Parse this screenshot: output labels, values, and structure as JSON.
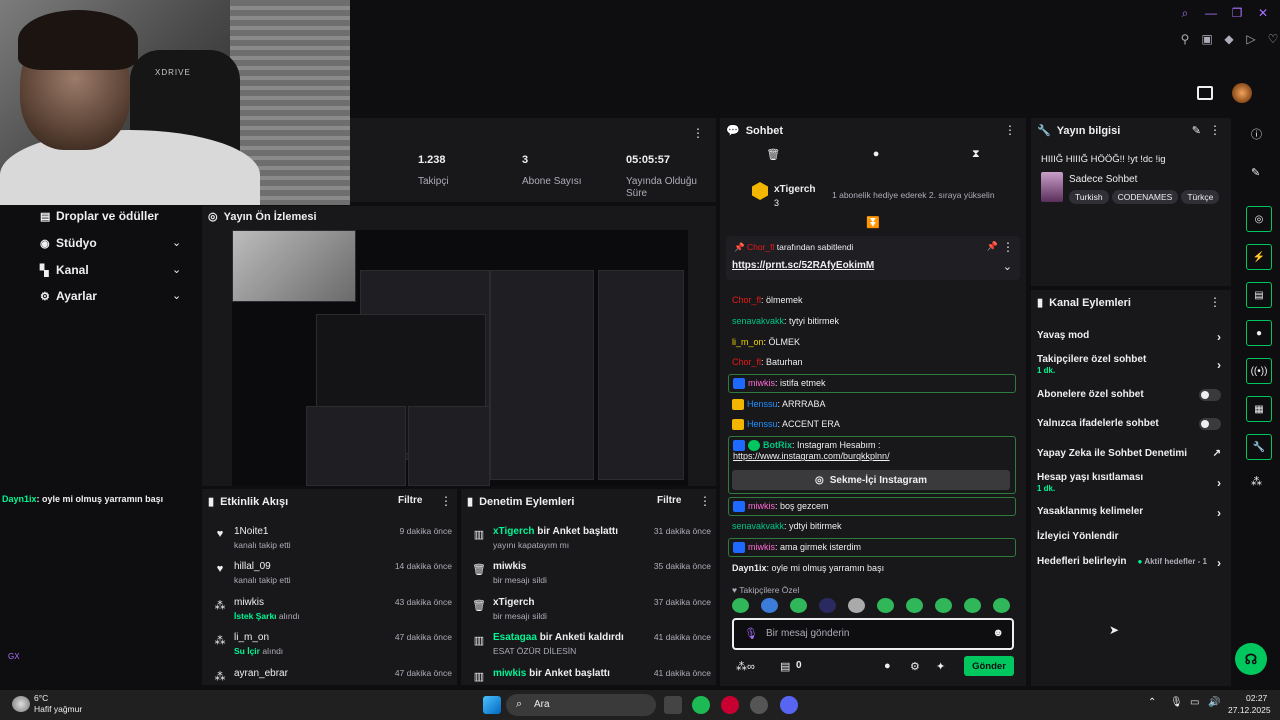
{
  "stats": [
    {
      "value": "1.238",
      "label": "Takipçi"
    },
    {
      "value": "3",
      "label": "Abone Sayısı"
    },
    {
      "value": "05:05:57",
      "label": "Yayında Olduğu Süre"
    }
  ],
  "leftnav": {
    "items": [
      {
        "label": "Droplar ve ödüller"
      },
      {
        "label": "Stüdyo"
      },
      {
        "label": "Kanal"
      },
      {
        "label": "Ayarlar"
      }
    ]
  },
  "cam": {
    "chair_brand": "XDRIVE"
  },
  "overlay_chat": {
    "user": "Dayn1ix",
    "text": ": oyle mi olmuş yarramın başı"
  },
  "preview": {
    "title": "Yayın Ön İzlemesi"
  },
  "activity": {
    "title": "Etkinlik Akışı",
    "filter": "Filtre",
    "items": [
      {
        "name": "1Noite1",
        "sub": "kanalı takip etti",
        "time": "9 dakika önce",
        "icon": "heart-icon"
      },
      {
        "name": "hillal_09",
        "sub": "kanalı takip etti",
        "time": "14 dakika önce",
        "icon": "heart-icon"
      },
      {
        "name": "miwkis",
        "sub": "İstek Şarkı",
        "sub2": "alındı",
        "time": "43 dakika önce",
        "icon": "points-icon"
      },
      {
        "name": "li_m_on",
        "sub": "Su İçir",
        "sub2": "alındı",
        "time": "47 dakika önce",
        "icon": "points-icon"
      },
      {
        "name": "ayran_ebrar",
        "sub": "",
        "time": "47 dakika önce",
        "icon": "points-icon"
      }
    ]
  },
  "mod": {
    "title": "Denetim Eylemleri",
    "filter": "Filtre",
    "items": [
      {
        "name": "xTigerch",
        "action": "bir Anket başlattı",
        "sub": "yayını kapatayım mı",
        "time": "31 dakika önce"
      },
      {
        "name": "miwkis",
        "action": "",
        "sub": "bir mesajı sildi",
        "time": "35 dakika önce"
      },
      {
        "name": "xTigerch",
        "action": "",
        "sub": "bir mesajı sildi",
        "time": "37 dakika önce"
      },
      {
        "name": "Esatagaa",
        "action": "bir Anketi kaldırdı",
        "sub": "ESAT ÖZÜR DİLESİN",
        "time": "41 dakika önce"
      },
      {
        "name": "miwkis",
        "action": "bir Anket başlattı",
        "sub": "",
        "time": "41 dakika önce"
      }
    ]
  },
  "chat": {
    "title": "Sohbet",
    "hype": {
      "user": "xTigerch",
      "count": "3",
      "text": "1 abonelik hediye ederek 2. sıraya yükselin"
    },
    "pinned": {
      "by": "Chor_fl",
      "by_suffix": "tarafından sabitlendi",
      "link": "https://prnt.sc/52RAfyEokimM"
    },
    "messages": [
      {
        "user": "Chor_fl",
        "text": ": ölmemek",
        "color": "red"
      },
      {
        "user": "senavakvakk",
        "text": ": tytyi bitirmek",
        "color": "green"
      },
      {
        "user": "li_m_on",
        "text": ": ÖLMEK",
        "color": "yellow"
      },
      {
        "user": "Chor_fl",
        "text": ": Baturhan",
        "color": "red"
      },
      {
        "user": "miwkis",
        "text": ": istifa etmek",
        "color": "pink"
      },
      {
        "user": "Henssu",
        "text": ": ARRRABA",
        "color": "blue"
      },
      {
        "user": "Henssu",
        "text": ": ACCENT ERA",
        "color": "blue"
      },
      {
        "user": "BotRix",
        "text": ": Instagram Hesabım :",
        "link": "https://www.instagram.com/burqkkplnn/",
        "color": "green"
      },
      {
        "user": "miwkis",
        "text": ": boş gezcem",
        "color": "pink"
      },
      {
        "user": "senavakvakk",
        "text": ": ydtyi bitirmek",
        "color": "green"
      },
      {
        "user": "miwkis",
        "text": ": ama girmek isterdim",
        "color": "pink"
      },
      {
        "user": "Dayn1ix",
        "text": ": oyle mi olmuş yarramın başı",
        "color": "white"
      }
    ],
    "insta_button": "Sekme-İçi Instagram",
    "emote_label": "Takipçilere Özel",
    "input_placeholder": "Bir mesaj gönderin",
    "points": "0",
    "send": "Gönder"
  },
  "stream_info": {
    "title": "Yayın bilgisi",
    "stream_title": "HIIIĞ HIIIĞ HÖÖĞ!! !yt !dc !ig",
    "category": "Sadece Sohbet",
    "tags": [
      "Turkish",
      "CODENAMES",
      "Türkçe"
    ]
  },
  "actions": {
    "title": "Kanal Eylemleri",
    "items": [
      {
        "label": "Yavaş mod",
        "control": "arrow"
      },
      {
        "label": "Takipçilere özel sohbet",
        "sub": "1 dk.",
        "control": "arrow"
      },
      {
        "label": "Abonelere özel sohbet",
        "control": "toggle"
      },
      {
        "label": "Yalnızca ifadelerle sohbet",
        "control": "toggle"
      },
      {
        "label": "Yapay Zeka ile Sohbet Denetimi",
        "control": "external"
      },
      {
        "label": "Hesap yaşı kısıtlaması",
        "sub": "1 dk.",
        "control": "arrow"
      },
      {
        "label": "Yasaklanmış kelimeler",
        "control": "arrow"
      },
      {
        "label": "İzleyici Yönlendir",
        "control": "none"
      },
      {
        "label": "Hedefleri belirleyin",
        "extra": "Aktif hedefler - 1",
        "control": "arrow"
      }
    ]
  },
  "taskbar": {
    "weather_temp": "6°C",
    "weather_desc": "Hafif yağmur",
    "search": "Ara",
    "time": "02:27",
    "date": "27.12.2025",
    "gx": "GX"
  },
  "colors": {
    "accent": "#a970ff",
    "green": "#00c75e",
    "panel": "#18181b",
    "bg": "#0e0e10"
  }
}
